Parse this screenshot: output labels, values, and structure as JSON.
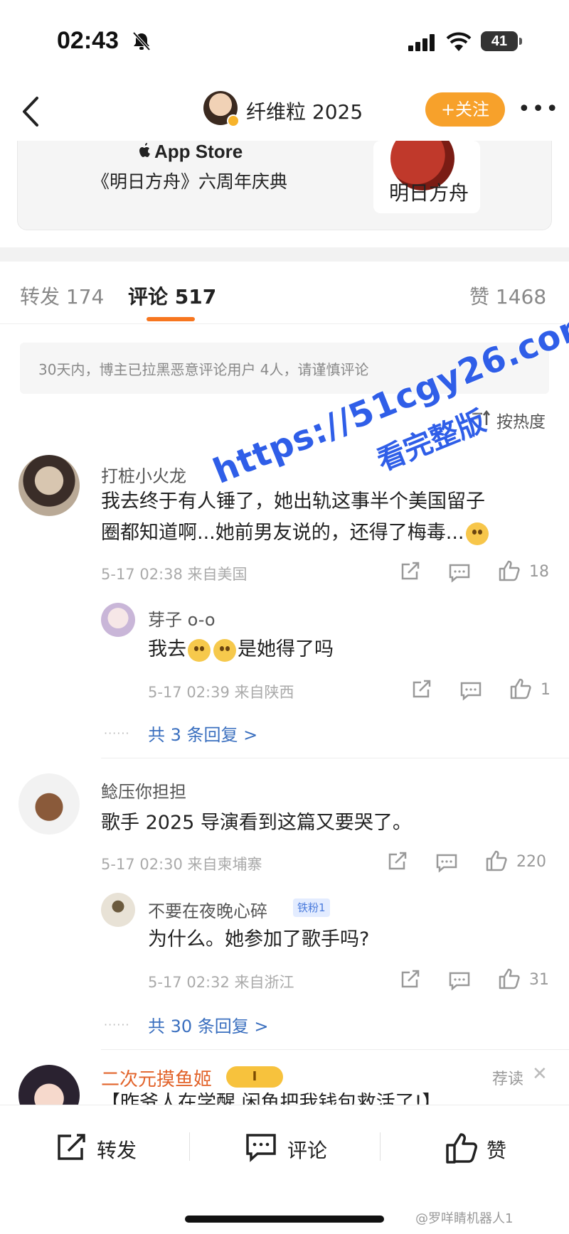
{
  "status_bar": {
    "time": "02:43",
    "battery": "41"
  },
  "nav": {
    "title": "纤维粒 2025",
    "follow_label": "+关注",
    "more": "•••"
  },
  "ad": {
    "store": "App Store",
    "text": "《明日方舟》六周年庆典",
    "art_logo": "明日方舟"
  },
  "tabs": [
    {
      "label": "转发",
      "count": "174"
    },
    {
      "label": "评论",
      "count": "517"
    },
    {
      "label": "赞",
      "count": "1468"
    }
  ],
  "notice": "30天内，博主已拉黑恶意评论用户 4人，请谨慎评论",
  "sort_label": "按热度",
  "watermark": {
    "line1": "https://51cgy26.com",
    "line2": "看完整版"
  },
  "comments": [
    {
      "user": "打桩小火龙",
      "text_line1": "我去终于有人锤了，她出轨这事半个美国留子",
      "text_line2": "圈都知道啊...她前男友说的，还得了梅毒...",
      "time": "5-17 02:38",
      "location": "来自美国",
      "likes": "18",
      "reply": {
        "user": "芽子 o-o",
        "text_prefix": "我去",
        "text_suffix": "是她得了吗",
        "time": "5-17 02:39",
        "location": "来自陕西",
        "likes": "1"
      },
      "more_replies": "共 3 条回复 >"
    },
    {
      "user": "鲶压你担担",
      "text_line1": "歌手 2025 导演看到这篇又要哭了。",
      "time": "5-17 02:30",
      "location": "来自柬埔寨",
      "likes": "220",
      "reply": {
        "user": "不要在夜晚心碎",
        "badge": "铁粉1",
        "text_line1": "为什么。她参加了歌手吗?",
        "time": "5-17 02:32",
        "location": "来自浙江",
        "likes": "31"
      },
      "more_replies": "共 30 条回复 >"
    },
    {
      "user": "二次元摸鱼姬",
      "badge": "I",
      "recommend": "荐读",
      "text_line1": "【昨爷人在学醒 闲鱼把我钱包救活了!】"
    }
  ],
  "bottom_bar": {
    "repost": "转发",
    "comment": "评论",
    "like": "赞"
  },
  "credit": "@罗咩睛机器人1",
  "colors": {
    "accent": "#f7761f",
    "follow": "#f7a12b",
    "link": "#3a6fbf",
    "watermark": "#2f5ee8"
  }
}
